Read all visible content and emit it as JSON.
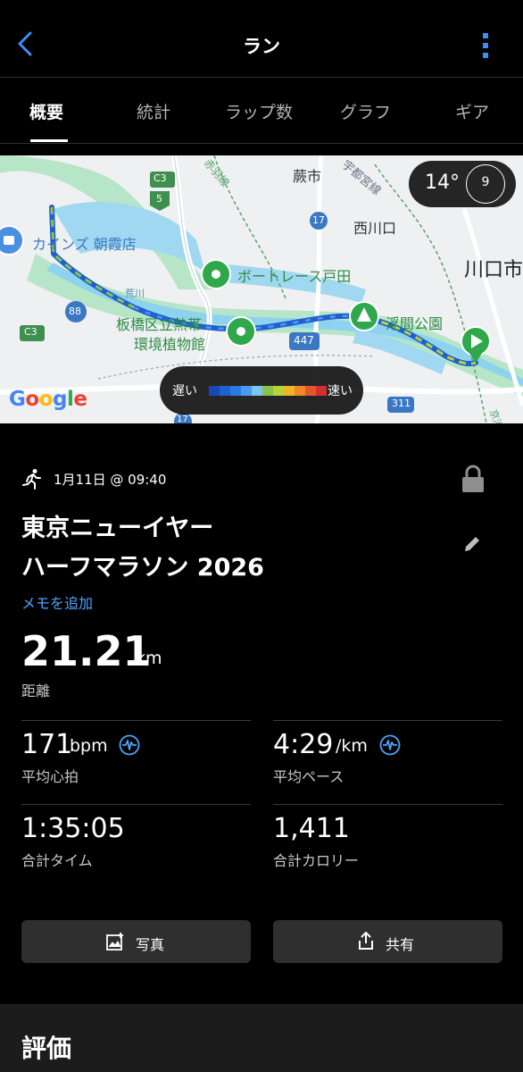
{
  "header": {
    "title": "ラン"
  },
  "tabs": [
    "概要",
    "統計",
    "ラップ数",
    "グラフ",
    "ギア"
  ],
  "map": {
    "labels": {
      "warabi": "蕨市",
      "utsunomiya": "宇都宮線",
      "nishikawaguchi": "西川口",
      "kawaguchi": "川口市",
      "cainz": "カインズ 朝霞店",
      "boatrace": "ボートレース戸田",
      "botanic1": "板橋区立熱帯",
      "botanic2": "環境植物館",
      "ukima": "浮間公園",
      "keihin": "京浜東北",
      "rail_left": "赤羽線",
      "river": "荒川"
    },
    "route_badges": [
      "C3",
      "5",
      "17",
      "88",
      "C3",
      "447",
      "311",
      "17"
    ],
    "weather": {
      "temp": "14°",
      "wind": "9"
    },
    "legend": {
      "slow": "遅い",
      "fast": "速い",
      "colors": [
        "#1a47b8",
        "#1f5fd0",
        "#2c7ae0",
        "#4c9af0",
        "#7ac3f2",
        "#8bc34a",
        "#b6d43a",
        "#f0b429",
        "#ef8a2c",
        "#e5562b",
        "#d32f2f"
      ]
    },
    "attribution": "Google"
  },
  "activity": {
    "date": "1月11日 @ 09:40",
    "title_line1": "東京ニューイヤー",
    "title_line2": "ハーフマラソン 2026",
    "add_memo": "メモを追加",
    "distance": "21.21",
    "distance_unit": "km",
    "distance_label": "距離"
  },
  "stats": {
    "heart_rate": {
      "value": "171",
      "unit": "bpm",
      "label": "平均心拍"
    },
    "pace": {
      "value": "4:29",
      "unit": "/km",
      "label": "平均ペース"
    },
    "time": {
      "value": "1:35:05",
      "label": "合計タイム"
    },
    "calories": {
      "value": "1,411",
      "label": "合計カロリー"
    }
  },
  "buttons": {
    "photo": "写真",
    "share": "共有"
  },
  "rating": {
    "label": "評価"
  }
}
